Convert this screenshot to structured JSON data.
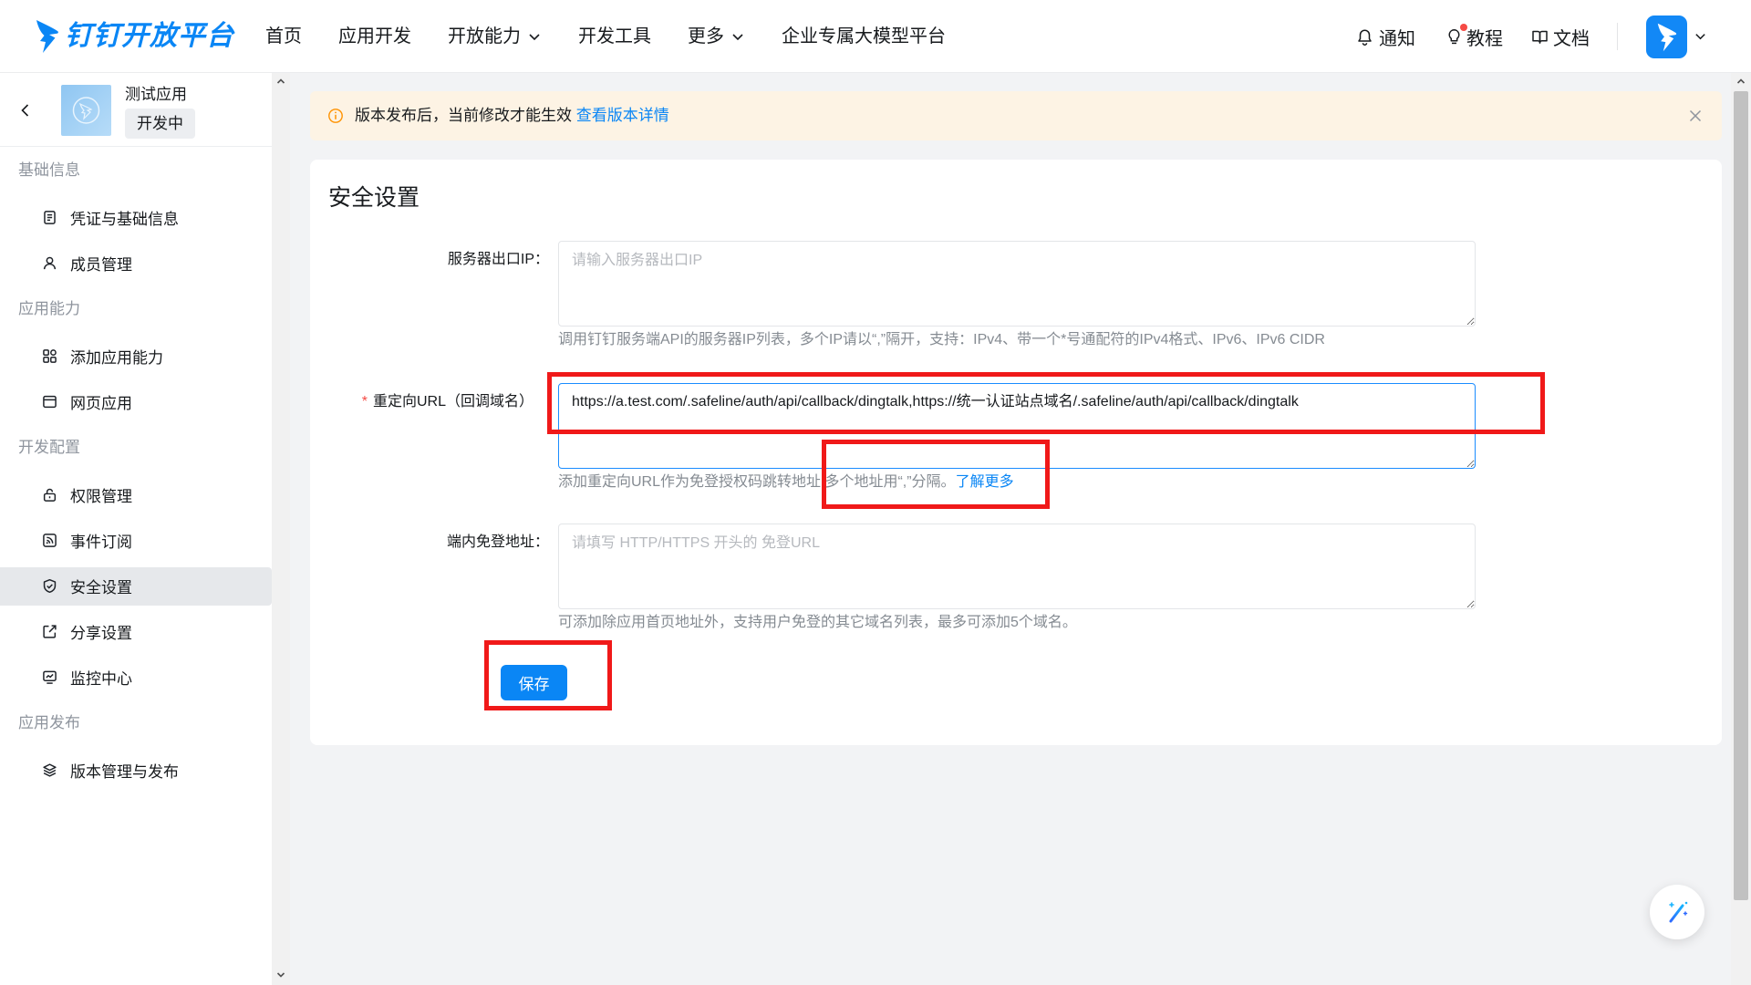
{
  "header": {
    "logo_text": "钉钉开放平台",
    "nav": [
      {
        "label": "首页",
        "has_dropdown": false
      },
      {
        "label": "应用开发",
        "has_dropdown": false
      },
      {
        "label": "开放能力",
        "has_dropdown": true
      },
      {
        "label": "开发工具",
        "has_dropdown": false
      },
      {
        "label": "更多",
        "has_dropdown": true
      },
      {
        "label": "企业专属大模型平台",
        "has_dropdown": false
      }
    ],
    "actions": {
      "notify": {
        "label": "通知",
        "icon": "bell-icon"
      },
      "tutorial": {
        "label": "教程",
        "icon": "lightbulb-icon",
        "has_unread_dot": true
      },
      "docs": {
        "label": "文档",
        "icon": "book-icon"
      }
    }
  },
  "sidebar": {
    "app_name": "测试应用",
    "app_status": "开发中",
    "sections": [
      {
        "title": "基础信息",
        "items": [
          {
            "label": "凭证与基础信息",
            "icon": "file-text-icon"
          },
          {
            "label": "成员管理",
            "icon": "user-icon"
          }
        ]
      },
      {
        "title": "应用能力",
        "items": [
          {
            "label": "添加应用能力",
            "icon": "app-grid-icon"
          },
          {
            "label": "网页应用",
            "icon": "browser-icon"
          }
        ]
      },
      {
        "title": "开发配置",
        "items": [
          {
            "label": "权限管理",
            "icon": "lock-icon"
          },
          {
            "label": "事件订阅",
            "icon": "rss-icon"
          },
          {
            "label": "安全设置",
            "icon": "shield-icon",
            "active": true
          },
          {
            "label": "分享设置",
            "icon": "share-icon"
          },
          {
            "label": "监控中心",
            "icon": "monitor-icon"
          }
        ]
      },
      {
        "title": "应用发布",
        "items": [
          {
            "label": "版本管理与发布",
            "icon": "layers-icon"
          }
        ]
      }
    ]
  },
  "banner": {
    "text": "版本发布后，当前修改才能生效",
    "link": "查看版本详情"
  },
  "form": {
    "title": "安全设置",
    "fields": [
      {
        "label": "服务器出口IP：",
        "required": false,
        "placeholder": "请输入服务器出口IP",
        "help": "调用钉钉服务端API的服务器IP列表，多个IP请以“,”隔开，支持：IPv4、带一个*号通配符的IPv4格式、IPv6、IPv6 CIDR"
      },
      {
        "label": "重定向URL（回调域名）",
        "required": true,
        "required_mark": "*",
        "value": "https://a.test.com/.safeline/auth/api/callback/dingtalk,https://统一认证站点域名/.safeline/auth/api/callback/dingtalk",
        "focused": true,
        "help": "添加重定向URL作为免登授权码跳转地址,多个地址用“,”分隔。",
        "help_link": "了解更多"
      },
      {
        "label": "端内免登地址：",
        "required": false,
        "placeholder": "请填写 HTTP/HTTPS 开头的 免登URL",
        "help": "可添加除应用首页地址外，支持用户免登的其它域名列表，最多可添加5个域名。"
      }
    ],
    "save_label": "保存"
  },
  "colors": {
    "brand": "#0a86f5",
    "required": "#f54a45",
    "banner_bg": "#fdf3e4",
    "warning_icon": "#ff9200",
    "annotation": "#f01919",
    "active_item_bg": "#e6e8eb"
  }
}
